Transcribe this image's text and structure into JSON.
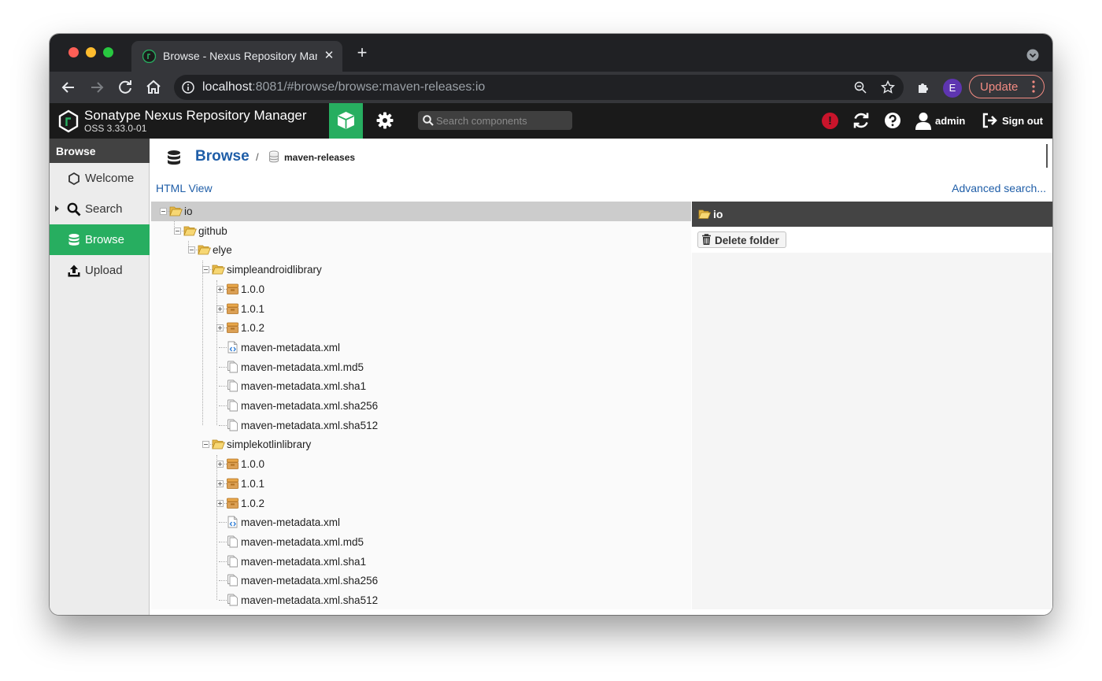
{
  "browser": {
    "tab_title": "Browse - Nexus Repository Manager",
    "url_host": "localhost",
    "url_rest": ":8081/#browse/browse:maven-releases:io",
    "profile_initial": "E",
    "update_label": "Update"
  },
  "app": {
    "name": "Sonatype Nexus Repository Manager",
    "version": "OSS 3.33.0-01",
    "search_placeholder": "Search components",
    "alert_glyph": "!",
    "user_label": "admin",
    "signout_label": "Sign out",
    "accent_color": "#27ae60"
  },
  "sidebar": {
    "title": "Browse",
    "items": [
      {
        "label": "Welcome",
        "icon": "hexagon-icon"
      },
      {
        "label": "Search",
        "icon": "search-icon"
      },
      {
        "label": "Browse",
        "icon": "database-icon",
        "selected": true
      },
      {
        "label": "Upload",
        "icon": "upload-icon"
      }
    ]
  },
  "breadcrumb": {
    "title": "Browse",
    "separator": "/",
    "repository": "maven-releases"
  },
  "links": {
    "html_view": "HTML View",
    "advanced_search": "Advanced search..."
  },
  "tree": {
    "nodes": [
      {
        "label": "io",
        "depth": 0,
        "type": "folder-open",
        "expander": "minus",
        "selected": true
      },
      {
        "label": "github",
        "depth": 1,
        "type": "folder-open",
        "expander": "minus"
      },
      {
        "label": "elye",
        "depth": 2,
        "type": "folder-open",
        "expander": "minus"
      },
      {
        "label": "simpleandroidlibrary",
        "depth": 3,
        "type": "folder-open",
        "expander": "minus"
      },
      {
        "label": "1.0.0",
        "depth": 4,
        "type": "component",
        "expander": "plus"
      },
      {
        "label": "1.0.1",
        "depth": 4,
        "type": "component",
        "expander": "plus"
      },
      {
        "label": "1.0.2",
        "depth": 4,
        "type": "component",
        "expander": "plus"
      },
      {
        "label": "maven-metadata.xml",
        "depth": 4,
        "type": "xml",
        "expander": "none"
      },
      {
        "label": "maven-metadata.xml.md5",
        "depth": 4,
        "type": "file",
        "expander": "none"
      },
      {
        "label": "maven-metadata.xml.sha1",
        "depth": 4,
        "type": "file",
        "expander": "none"
      },
      {
        "label": "maven-metadata.xml.sha256",
        "depth": 4,
        "type": "file",
        "expander": "none"
      },
      {
        "label": "maven-metadata.xml.sha512",
        "depth": 4,
        "type": "file",
        "expander": "none"
      },
      {
        "label": "simplekotlinlibrary",
        "depth": 3,
        "type": "folder-open",
        "expander": "minus"
      },
      {
        "label": "1.0.0",
        "depth": 4,
        "type": "component",
        "expander": "plus"
      },
      {
        "label": "1.0.1",
        "depth": 4,
        "type": "component",
        "expander": "plus"
      },
      {
        "label": "1.0.2",
        "depth": 4,
        "type": "component",
        "expander": "plus"
      },
      {
        "label": "maven-metadata.xml",
        "depth": 4,
        "type": "xml",
        "expander": "none"
      },
      {
        "label": "maven-metadata.xml.md5",
        "depth": 4,
        "type": "file",
        "expander": "none"
      },
      {
        "label": "maven-metadata.xml.sha1",
        "depth": 4,
        "type": "file",
        "expander": "none"
      },
      {
        "label": "maven-metadata.xml.sha256",
        "depth": 4,
        "type": "file",
        "expander": "none"
      },
      {
        "label": "maven-metadata.xml.sha512",
        "depth": 4,
        "type": "file",
        "expander": "none"
      }
    ]
  },
  "detail": {
    "title": "io",
    "delete_label": "Delete folder"
  }
}
